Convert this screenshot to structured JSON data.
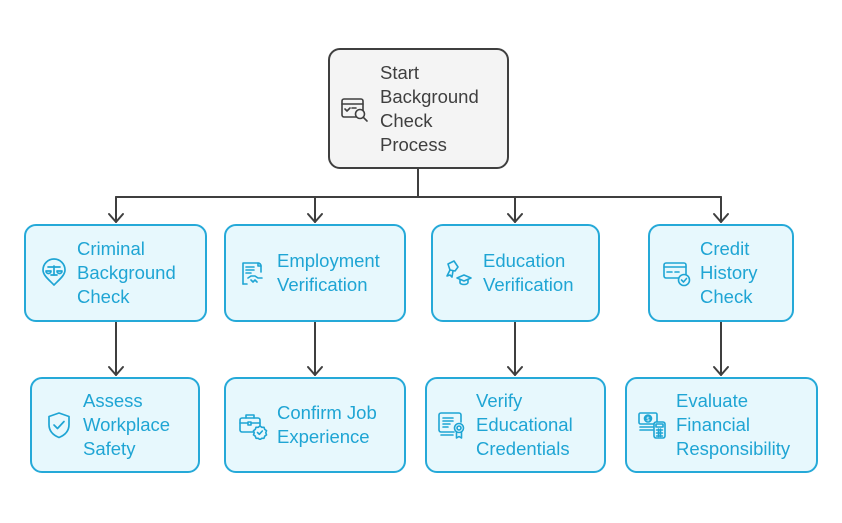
{
  "diagram": {
    "type": "flowchart-tree",
    "colors": {
      "root_border": "#3f3f3f",
      "root_fill": "#f4f4f4",
      "root_text": "#3f3f3f",
      "child_border": "#25a9d8",
      "child_fill": "#e7f8fd",
      "child_text": "#1fa5d4",
      "connector": "#3f3f3f"
    },
    "root": {
      "id": "start",
      "label": "Start\nBackground\nCheck\nProcess",
      "icon": "checklist-search-icon"
    },
    "level1": [
      {
        "id": "criminal",
        "label": "Criminal\nBackground\nCheck",
        "icon": "scales-pin-icon"
      },
      {
        "id": "employment",
        "label": "Employment\nVerification",
        "icon": "contract-handshake-icon"
      },
      {
        "id": "education",
        "label": "Education\nVerification",
        "icon": "diploma-cap-icon"
      },
      {
        "id": "credit",
        "label": "Credit\nHistory\nCheck",
        "icon": "credit-card-check-icon"
      }
    ],
    "level2": [
      {
        "id": "assess",
        "parent": "criminal",
        "label": "Assess\nWorkplace\nSafety",
        "icon": "shield-check-icon"
      },
      {
        "id": "confirm",
        "parent": "employment",
        "label": "Confirm Job\nExperience",
        "icon": "briefcase-badge-check-icon"
      },
      {
        "id": "verify",
        "parent": "education",
        "label": "Verify\nEducational\nCredentials",
        "icon": "certificate-icon"
      },
      {
        "id": "evaluate",
        "parent": "credit",
        "label": "Evaluate\nFinancial\nResponsibility",
        "icon": "money-calculator-icon"
      }
    ],
    "edges": [
      {
        "from": "start",
        "to": "criminal"
      },
      {
        "from": "start",
        "to": "employment"
      },
      {
        "from": "start",
        "to": "education"
      },
      {
        "from": "start",
        "to": "credit"
      },
      {
        "from": "criminal",
        "to": "assess"
      },
      {
        "from": "employment",
        "to": "confirm"
      },
      {
        "from": "education",
        "to": "verify"
      },
      {
        "from": "credit",
        "to": "evaluate"
      }
    ]
  }
}
